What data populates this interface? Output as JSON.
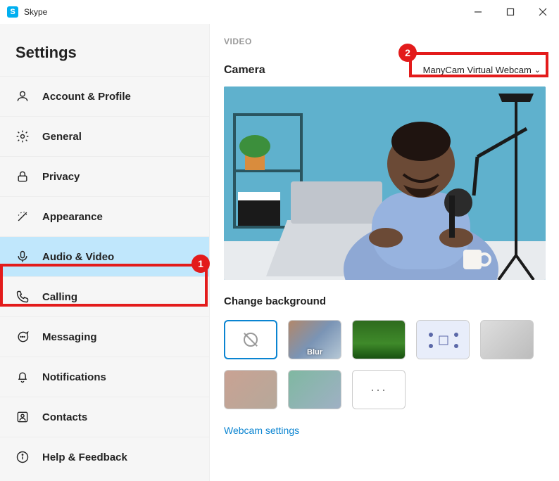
{
  "app": {
    "title": "Skype"
  },
  "settings_title": "Settings",
  "sidebar": {
    "items": [
      {
        "label": "Account & Profile"
      },
      {
        "label": "General"
      },
      {
        "label": "Privacy"
      },
      {
        "label": "Appearance"
      },
      {
        "label": "Audio & Video"
      },
      {
        "label": "Calling"
      },
      {
        "label": "Messaging"
      },
      {
        "label": "Notifications"
      },
      {
        "label": "Contacts"
      },
      {
        "label": "Help & Feedback"
      }
    ]
  },
  "video": {
    "section_title": "VIDEO",
    "camera_label": "Camera",
    "camera_selected": "ManyCam Virtual Webcam",
    "change_bg_title": "Change background",
    "blur_label": "Blur",
    "more_label": "···",
    "webcam_settings_link": "Webcam settings"
  },
  "annotations": {
    "badge1": "1",
    "badge2": "2"
  }
}
